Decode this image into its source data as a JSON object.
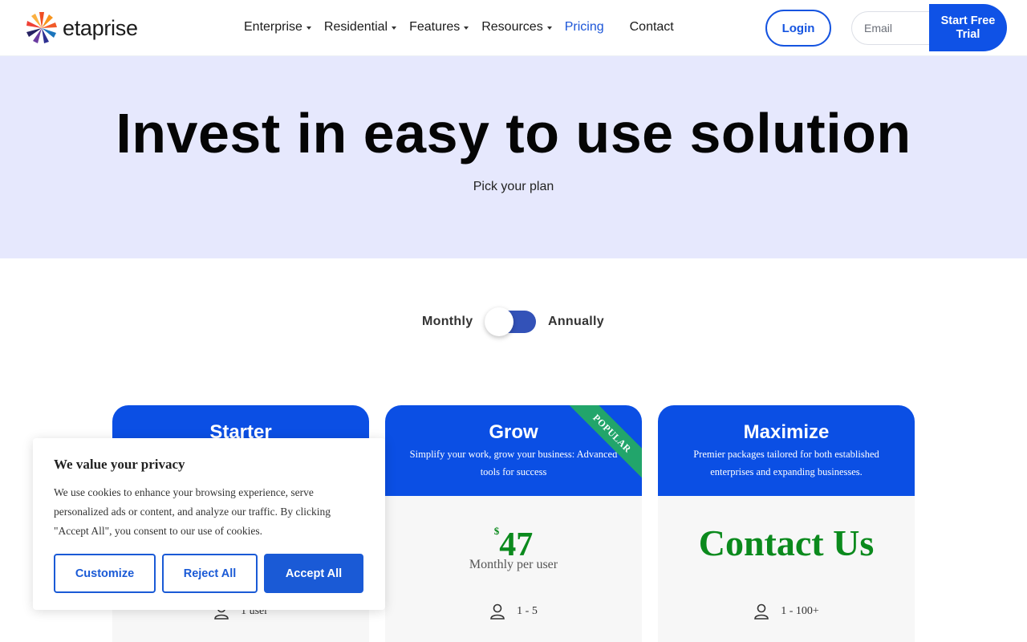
{
  "brand": {
    "name": "etaprise"
  },
  "nav": {
    "items": [
      {
        "label": "Enterprise",
        "dropdown": true
      },
      {
        "label": "Residential",
        "dropdown": true
      },
      {
        "label": "Features",
        "dropdown": true
      },
      {
        "label": "Resources",
        "dropdown": true
      },
      {
        "label": "Pricing",
        "dropdown": false,
        "active": true
      },
      {
        "label": "Contact",
        "dropdown": false
      }
    ],
    "login_label": "Login",
    "email_placeholder": "Email",
    "trial_label_line1": "Start Free",
    "trial_label_line2": "Trial"
  },
  "hero": {
    "title": "Invest in easy to use solution",
    "subtitle": "Pick your plan"
  },
  "billing_toggle": {
    "left_label": "Monthly",
    "right_label": "Annually",
    "selected": "Annually"
  },
  "plans": [
    {
      "name": "Starter",
      "users": "1 user"
    },
    {
      "name": "Grow",
      "description": "Simplify your work, grow your business: Advanced tools for success",
      "badge": "POPULAR",
      "currency": "$",
      "price": "47",
      "period": "Monthly per user",
      "users": "1 - 5"
    },
    {
      "name": "Maximize",
      "description": "Premier packages tailored for both established enterprises and expanding businesses.",
      "price_text": "Contact Us",
      "users": "1 - 100+"
    }
  ],
  "cookie_banner": {
    "title": "We value your privacy",
    "text": "We use cookies to enhance your browsing experience, serve personalized ads or content, and analyze our traffic. By clicking \"Accept All\", you consent to our use of cookies.",
    "customize_label": "Customize",
    "reject_label": "Reject All",
    "accept_label": "Accept All"
  },
  "colors": {
    "primary": "#0b4fe4",
    "hero_bg": "#e6e8fd",
    "price_green": "#0b8a1d",
    "ribbon_green": "#22a56b",
    "toggle_track": "#3352b8"
  }
}
